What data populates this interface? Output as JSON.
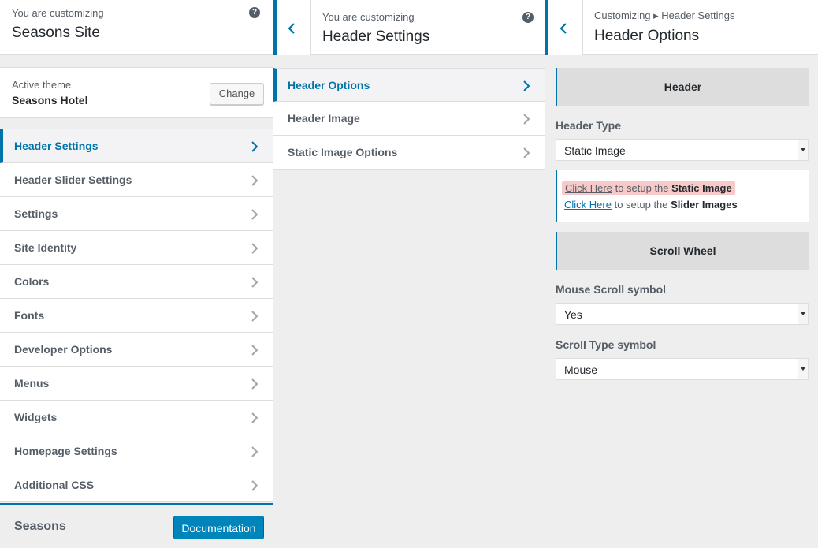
{
  "panel1": {
    "subtitle": "You are customizing",
    "title": "Seasons Site",
    "help_icon": "?",
    "active_theme_label": "Active theme",
    "theme_name": "Seasons Hotel",
    "change_button": "Change",
    "menu": [
      {
        "label": "Header Settings",
        "active": true
      },
      {
        "label": "Header Slider Settings"
      },
      {
        "label": "Settings"
      },
      {
        "label": "Site Identity"
      },
      {
        "label": "Colors"
      },
      {
        "label": "Fonts"
      },
      {
        "label": "Developer Options"
      },
      {
        "label": "Menus"
      },
      {
        "label": "Widgets"
      },
      {
        "label": "Homepage Settings"
      },
      {
        "label": "Additional CSS"
      }
    ],
    "footer_name": "Seasons",
    "documentation_button": "Documentation"
  },
  "panel2": {
    "subtitle": "You are customizing",
    "title": "Header Settings",
    "help_icon": "?",
    "menu": [
      {
        "label": "Header Options",
        "active": true
      },
      {
        "label": "Header Image"
      },
      {
        "label": "Static Image Options"
      }
    ]
  },
  "panel3": {
    "breadcrumb": "Customizing ▸ Header Settings",
    "title": "Header Options",
    "header_section": "Header",
    "header_type_label": "Header Type",
    "header_type_value": "Static Image",
    "link1_text": "Click Here",
    "link1_rest": " to setup the ",
    "link1_bold": "Static Image",
    "link2_text": "Click Here",
    "link2_rest": " to setup the ",
    "link2_bold": "Slider Images",
    "scroll_section": "Scroll Wheel",
    "mouse_scroll_label": "Mouse Scroll symbol",
    "mouse_scroll_value": "Yes",
    "scroll_type_label": "Scroll Type symbol",
    "scroll_type_value": "Mouse"
  },
  "colors": {
    "accent": "#0073aa",
    "button_primary": "#0085ba",
    "highlight": "#f8c9c9"
  }
}
